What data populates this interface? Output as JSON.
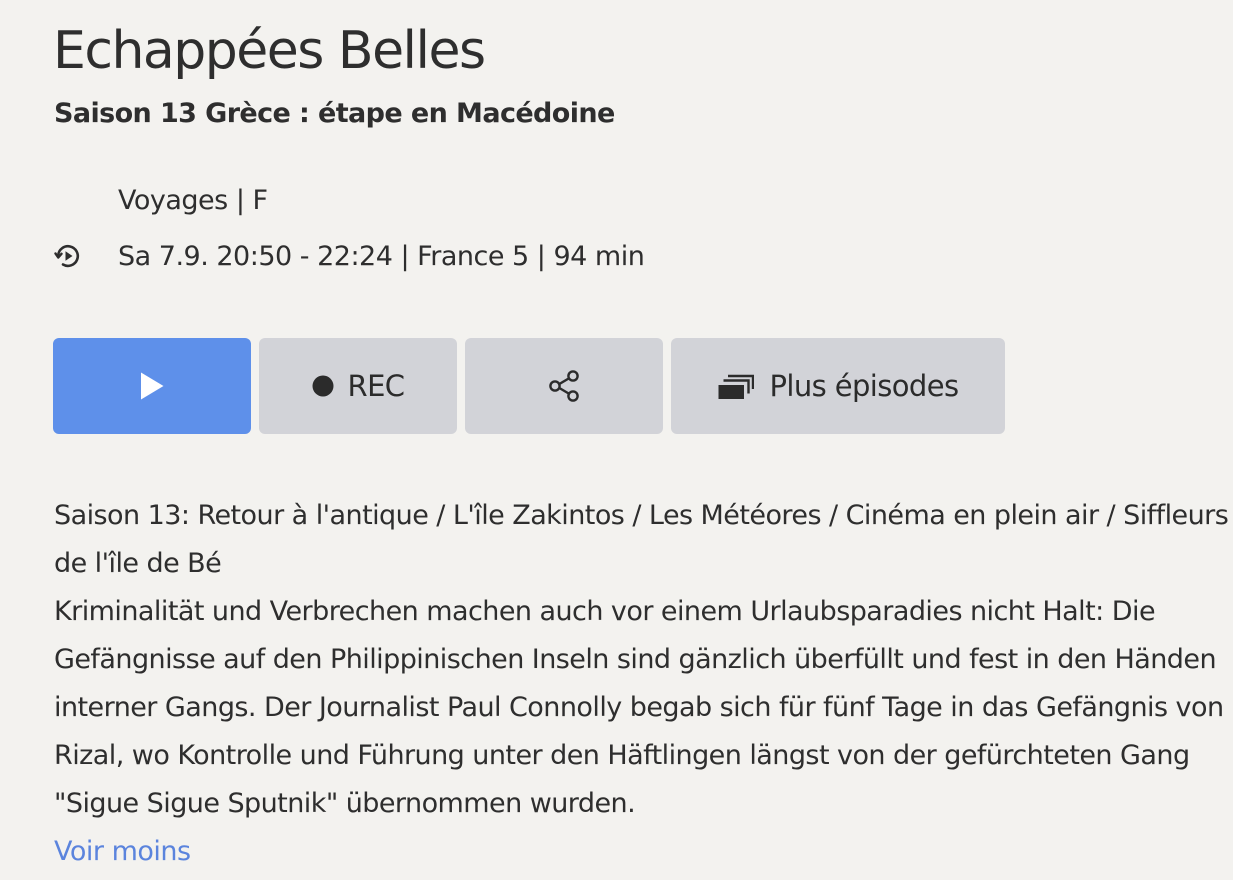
{
  "program": {
    "title": "Echappées Belles",
    "subtitle": "Saison 13 Grèce : étape en Macédoine"
  },
  "meta": {
    "genre_line": "Voyages | F",
    "airing_line": "Sa 7.9. 20:50 - 22:24 | France 5 | 94 min",
    "airing_icon": "replay-icon"
  },
  "actions": {
    "play_icon": "play-icon",
    "rec_label": "REC",
    "rec_icon": "record-dot-icon",
    "share_icon": "share-icon",
    "more_label": "Plus épisodes",
    "more_icon": "episodes-stack-icon"
  },
  "description": {
    "season_summary": "Saison 13: Retour à l'antique / L'île Zakintos / Les Météores / Cinéma en plein air / Siffleurs de l'île de Bé",
    "body": "Kriminalität und Verbrechen machen auch vor einem Urlaubsparadies nicht Halt: Die Gefängnisse auf den Philippinischen Inseln sind gänzlich überfüllt und fest in den Händen interner Gangs. Der Journalist Paul Connolly begab sich für fünf Tage in das Gefängnis von Rizal, wo Kontrolle und Führung unter den Häftlingen längst von der gefürchteten Gang \"Sigue Sigue Sputnik\" übernommen wurden."
  },
  "links": {
    "voir_moins": "Voir moins"
  },
  "colors": {
    "background": "#f3f2ef",
    "primary_button": "#5e90ea",
    "secondary_button": "#d2d3d8",
    "link": "#5b84dd",
    "text": "#2e2e2e"
  }
}
